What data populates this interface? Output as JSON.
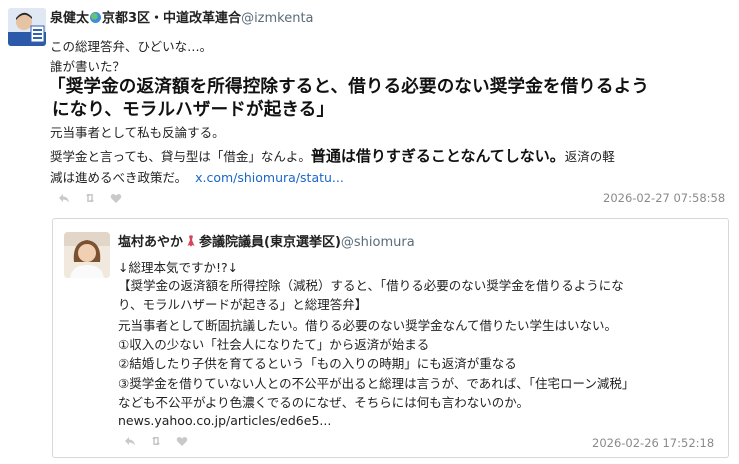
{
  "post": {
    "author_name": "泉健太",
    "author_suffix": "京都3区・中道改革連合",
    "handle": "@izmkenta",
    "text_lines": [
      "この総理答弁、ひどいな…。",
      "誰が書いた？"
    ],
    "headline_lines": [
      "「奨学金の返済額を所得控除すると、借りる必要のない奨学金を借りるよう",
      "になり、モラルハザードが起きる」"
    ],
    "after_headline": "元当事者として私も反論する。",
    "para_start": "奨学金と言っても、貸与型は「借金」なんよ。",
    "para_emphasis": "普通は借りすぎることなんてしない。",
    "para_end": "返済の軽",
    "para_line2": "減は進めるべき政策だ。",
    "link": "x.com/shiomura/statu...",
    "timestamp": "2026-02-27 07:58:58"
  },
  "quoted": {
    "author_name": "塩村あやか",
    "author_suffix": "参議院議員(東京選挙区)",
    "handle": "@shiomura",
    "lines": [
      "↓総理本気ですか!?↓",
      "【奨学金の返済額を所得控除（減税）すると、「借りる必要のない奨学金を借りるようにな",
      "り、モラルハザードが起きる」と総理答弁】",
      "元当事者として断固抗議したい。借りる必要のない奨学金なんて借りたい学生はいない。",
      "①収入の少ない「社会人になりたて」から返済が始まる",
      "②結婚したり子供を育てるという「もの入りの時期」にも返済が重なる",
      "③奨学金を借りていない人との不公平が出ると総理は言うが、であれば、「住宅ローン減税」",
      "なども不公平がより色濃くでるのになぜ、そちらには何も言わないのか。"
    ],
    "link": "news.yahoo.co.jp/articles/ed6e5...",
    "timestamp": "2026-02-26 17:52:18"
  },
  "icons": {
    "actions": [
      "reply-icon",
      "retweet-icon",
      "like-icon"
    ],
    "action_color": "#c9c9c9"
  },
  "colors": {
    "link": "#1a67c9",
    "handle": "#5b6b7a",
    "timestamp": "#8a8a8a"
  }
}
